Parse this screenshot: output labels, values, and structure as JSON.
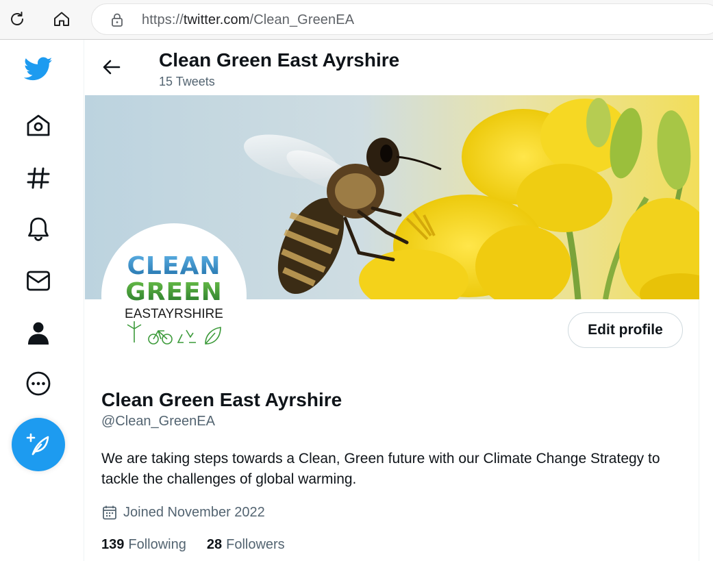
{
  "browser": {
    "url_prefix": "https://",
    "url_host": "twitter.com",
    "url_path": "/Clean_GreenEA"
  },
  "nav": {
    "items": [
      {
        "name": "twitter-logo-icon"
      },
      {
        "name": "home-icon"
      },
      {
        "name": "explore-hashtag-icon"
      },
      {
        "name": "notifications-bell-icon"
      },
      {
        "name": "messages-envelope-icon"
      },
      {
        "name": "profile-person-icon"
      },
      {
        "name": "more-icon"
      }
    ],
    "compose_icon": "compose-tweet-icon",
    "accent": "#1d9bf0"
  },
  "header": {
    "title": "Clean Green East Ayrshire",
    "tweet_count": "15 Tweets"
  },
  "avatar": {
    "line1": "CLEAN",
    "line2": "GREEN",
    "line3": "EASTAYRSHIRE"
  },
  "profile": {
    "edit_label": "Edit profile",
    "name": "Clean Green East Ayrshire",
    "handle": "@Clean_GreenEA",
    "bio": "We are taking steps towards a Clean, Green future with our Climate Change Strategy to tackle the challenges of global warming.",
    "joined": "Joined November 2022",
    "following_count": "139",
    "following_label": "Following",
    "followers_count": "28",
    "followers_label": "Followers"
  },
  "colors": {
    "text_primary": "#0f1419",
    "text_secondary": "#536471",
    "accent": "#1d9bf0",
    "logo_blue": "#2a7fb8",
    "logo_green": "#3c9a3a"
  }
}
